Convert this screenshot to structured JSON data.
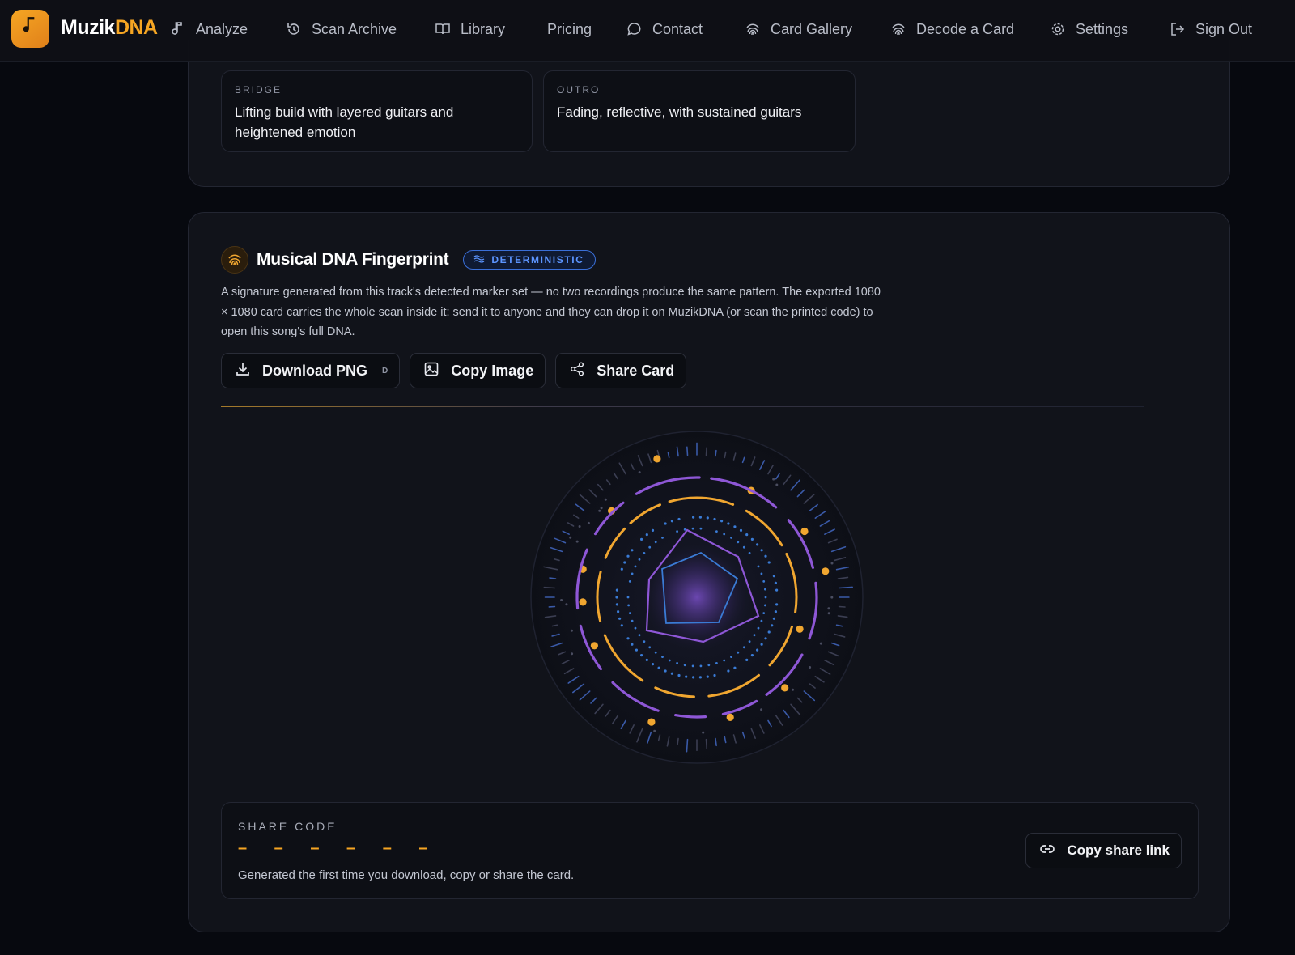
{
  "brand": {
    "name_part1": "Muzik",
    "name_part2": "DNA",
    "logo_icon": "music-note-icon",
    "accent": "#f6a623"
  },
  "nav": [
    {
      "label": "Analyze",
      "icon": "music-note-icon"
    },
    {
      "label": "Scan Archive",
      "icon": "history-icon"
    },
    {
      "label": "Library",
      "icon": "book-icon"
    },
    {
      "label": "Pricing",
      "icon": ""
    },
    {
      "label": "Contact",
      "icon": "chat-bubble-icon"
    },
    {
      "label": "Card Gallery",
      "icon": "fingerprint-icon"
    },
    {
      "label": "Decode a Card",
      "icon": "fingerprint-icon"
    },
    {
      "label": "Settings",
      "icon": "gear-icon"
    },
    {
      "label": "Sign Out",
      "icon": "sign-out-icon"
    }
  ],
  "sections": [
    {
      "label": "BRIDGE",
      "text": "Lifting build with layered guitars and heightened emotion"
    },
    {
      "label": "OUTRO",
      "text": "Fading, reflective, with sustained guitars"
    }
  ],
  "fingerprint": {
    "title": "Musical DNA Fingerprint",
    "badge": "DETERMINISTIC",
    "description": "A signature generated from this track's detected marker set — no two recordings produce the same pattern. The exported 1080 × 1080 card carries the whole scan inside it: send it to anyone and they can drop it on MuzikDNA (or scan the printed code) to open this song's full DNA.",
    "buttons": {
      "download": "Download PNG",
      "download_shortcut": "D",
      "copy": "Copy Image",
      "share": "Share Card"
    },
    "colors": {
      "gold": "#f0a630",
      "purple": "#8e57d6",
      "blue": "#3a7bd5"
    }
  },
  "share": {
    "label": "SHARE CODE",
    "code": "– – – – – –",
    "help": "Generated the first time you download, copy or share the card.",
    "button": "Copy share link"
  }
}
